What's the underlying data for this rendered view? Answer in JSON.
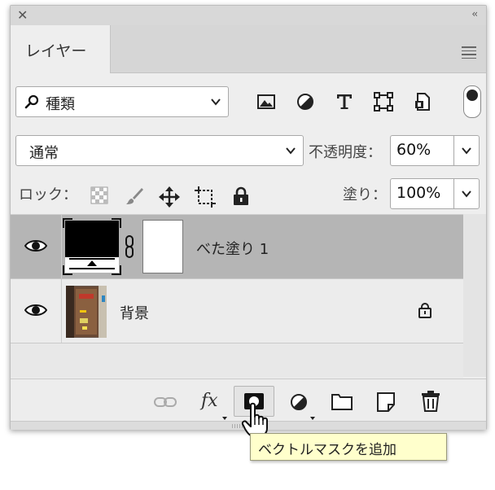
{
  "panel": {
    "tab_label": "レイヤー",
    "kind_filter": {
      "label": "種類",
      "icons": [
        "image-filter-icon",
        "adjustment-filter-icon",
        "type-filter-icon",
        "shape-filter-icon",
        "smart-object-filter-icon"
      ]
    },
    "blend_mode": "通常",
    "opacity_label": "不透明度：",
    "opacity_value": "60%",
    "lock_label": "ロック：",
    "fill_label": "塗り：",
    "fill_value": "100%",
    "layers": [
      {
        "name": "べた塗り 1",
        "selected": true,
        "visible": true
      },
      {
        "name": "背景",
        "selected": false,
        "visible": true,
        "locked": true
      }
    ],
    "footer_buttons": [
      "link-layers",
      "add-layer-style",
      "add-vector-mask",
      "create-fill-adjustment",
      "create-group",
      "create-new-layer",
      "delete-layer"
    ]
  },
  "tooltip": {
    "text": "ベクトルマスクを追加"
  },
  "colors": {
    "selected_row": "#b5b5b5",
    "tooltip_bg": "#ffffcc"
  }
}
